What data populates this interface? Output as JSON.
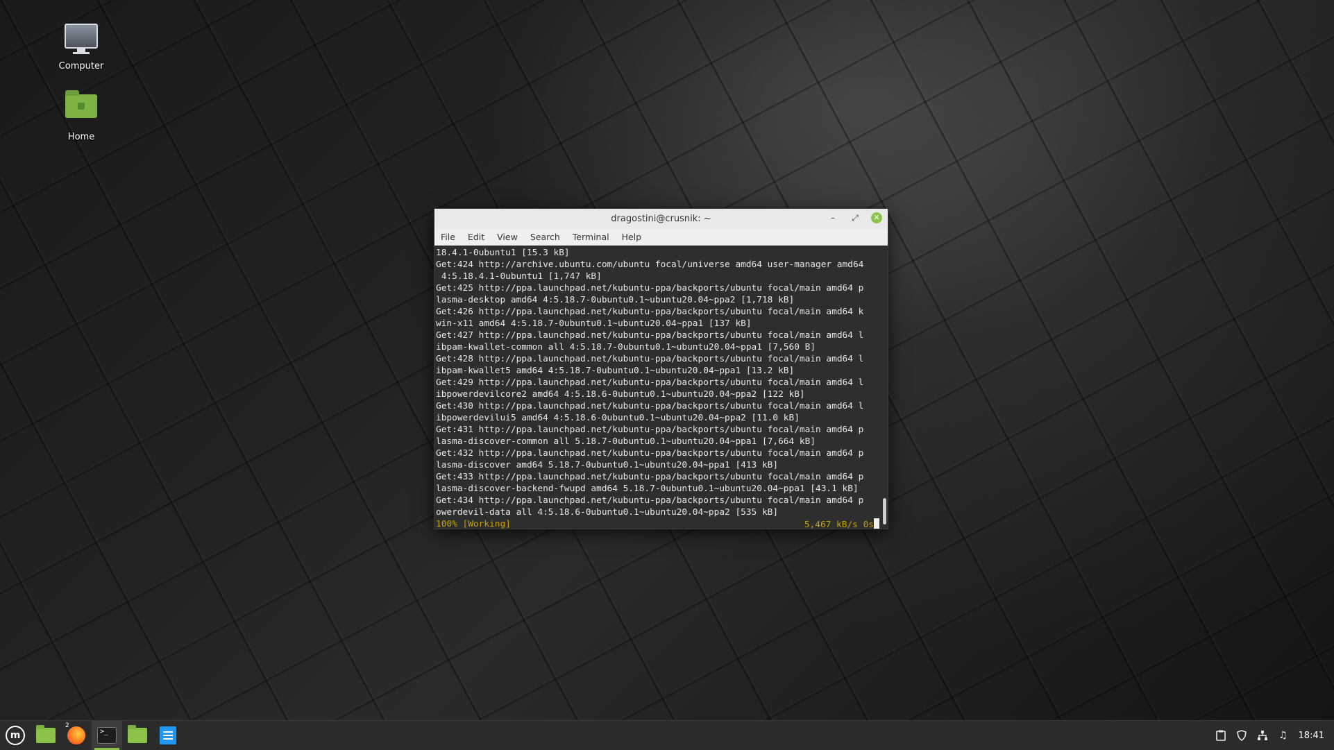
{
  "desktop": {
    "icons": [
      {
        "label": "Computer"
      },
      {
        "label": "Home"
      }
    ]
  },
  "terminal": {
    "title": "dragostini@crusnik: ~",
    "controls": {
      "minimize": "–",
      "maximize": "⤢",
      "close": "✕"
    },
    "menu": [
      "File",
      "Edit",
      "View",
      "Search",
      "Terminal",
      "Help"
    ],
    "lines": [
      "18.4.1-0ubuntu1 [15.3 kB]",
      "Get:424 http://archive.ubuntu.com/ubuntu focal/universe amd64 user-manager amd64",
      " 4:5.18.4.1-0ubuntu1 [1,747 kB]",
      "Get:425 http://ppa.launchpad.net/kubuntu-ppa/backports/ubuntu focal/main amd64 p",
      "lasma-desktop amd64 4:5.18.7-0ubuntu0.1~ubuntu20.04~ppa2 [1,718 kB]",
      "Get:426 http://ppa.launchpad.net/kubuntu-ppa/backports/ubuntu focal/main amd64 k",
      "win-x11 amd64 4:5.18.7-0ubuntu0.1~ubuntu20.04~ppa1 [137 kB]",
      "Get:427 http://ppa.launchpad.net/kubuntu-ppa/backports/ubuntu focal/main amd64 l",
      "ibpam-kwallet-common all 4:5.18.7-0ubuntu0.1~ubuntu20.04~ppa1 [7,560 B]",
      "Get:428 http://ppa.launchpad.net/kubuntu-ppa/backports/ubuntu focal/main amd64 l",
      "ibpam-kwallet5 amd64 4:5.18.7-0ubuntu0.1~ubuntu20.04~ppa1 [13.2 kB]",
      "Get:429 http://ppa.launchpad.net/kubuntu-ppa/backports/ubuntu focal/main amd64 l",
      "ibpowerdevilcore2 amd64 4:5.18.6-0ubuntu0.1~ubuntu20.04~ppa2 [122 kB]",
      "Get:430 http://ppa.launchpad.net/kubuntu-ppa/backports/ubuntu focal/main amd64 l",
      "ibpowerdevilui5 amd64 4:5.18.6-0ubuntu0.1~ubuntu20.04~ppa2 [11.0 kB]",
      "Get:431 http://ppa.launchpad.net/kubuntu-ppa/backports/ubuntu focal/main amd64 p",
      "lasma-discover-common all 5.18.7-0ubuntu0.1~ubuntu20.04~ppa1 [7,664 kB]",
      "Get:432 http://ppa.launchpad.net/kubuntu-ppa/backports/ubuntu focal/main amd64 p",
      "lasma-discover amd64 5.18.7-0ubuntu0.1~ubuntu20.04~ppa1 [413 kB]",
      "Get:433 http://ppa.launchpad.net/kubuntu-ppa/backports/ubuntu focal/main amd64 p",
      "lasma-discover-backend-fwupd amd64 5.18.7-0ubuntu0.1~ubuntu20.04~ppa1 [43.1 kB]",
      "Get:434 http://ppa.launchpad.net/kubuntu-ppa/backports/ubuntu focal/main amd64 p",
      "owerdevil-data all 4:5.18.6-0ubuntu0.1~ubuntu20.04~ppa2 [535 kB]"
    ],
    "status_left": "100% [Working]",
    "status_right": "5,467 kB/s 0s",
    "status_color": "#c4a000"
  },
  "taskbar": {
    "menu_logo": "m",
    "firefox_badge": "2",
    "terminal_glyph": ">_",
    "tray": {
      "clipboard_icon": "clipboard-icon",
      "shield_icon": "shield-icon",
      "network_icon": "network-icon",
      "sound_icon": "♫",
      "clock": "18:41"
    }
  },
  "colors": {
    "accent": "#8bc34a"
  }
}
